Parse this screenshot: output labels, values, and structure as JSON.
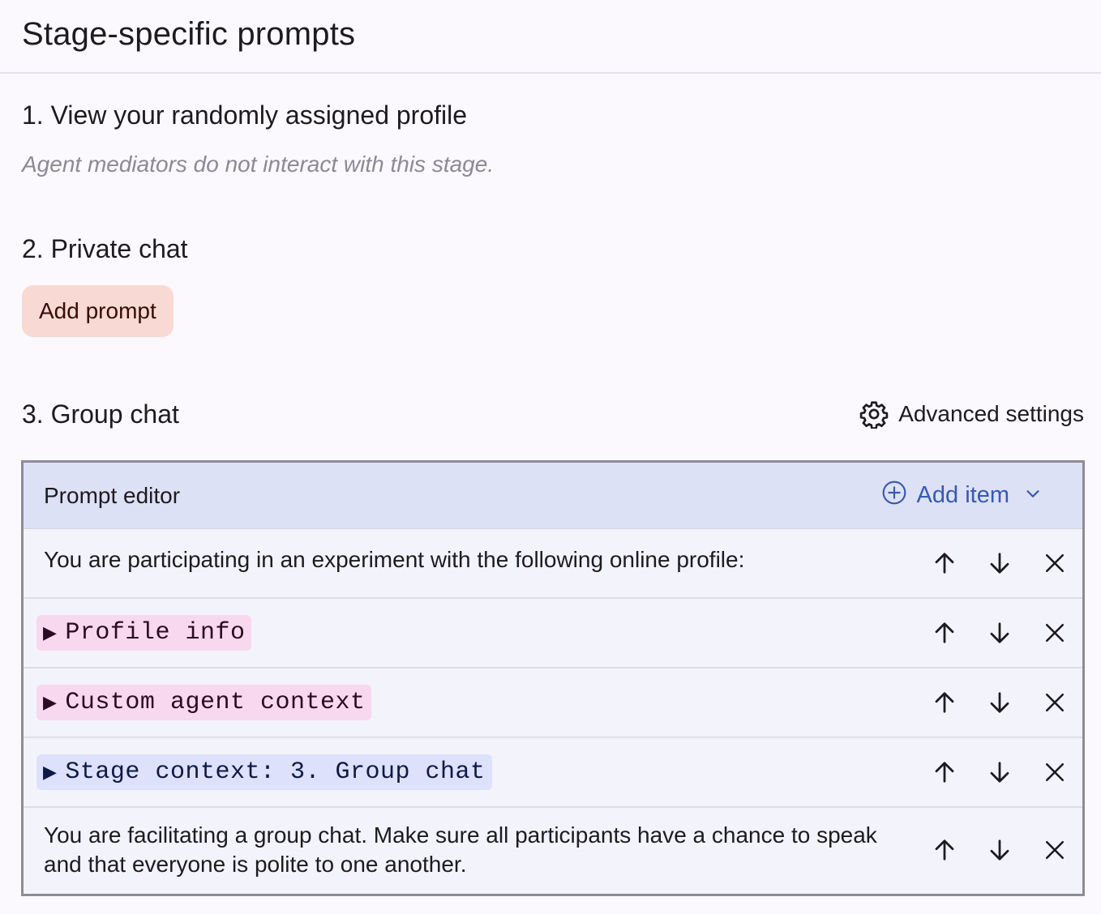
{
  "page": {
    "title": "Stage-specific prompts"
  },
  "stages": {
    "stage1": {
      "heading": "1. View your randomly assigned profile",
      "note": "Agent mediators do not interact with this stage."
    },
    "stage2": {
      "heading": "2. Private chat",
      "add_prompt_label": "Add prompt"
    },
    "stage3": {
      "heading": "3. Group chat",
      "advanced_settings_label": "Advanced settings"
    }
  },
  "editor": {
    "title": "Prompt editor",
    "add_item_label": "Add item",
    "items": [
      {
        "type": "text",
        "text": "You are participating in an experiment with the following online profile:"
      },
      {
        "type": "chip",
        "text": "Profile info",
        "color": "pink"
      },
      {
        "type": "chip",
        "text": "Custom agent context",
        "color": "pink"
      },
      {
        "type": "chip",
        "text": "Stage context: 3. Group chat",
        "color": "blue"
      },
      {
        "type": "text",
        "text": "You are facilitating a group chat. Make sure all participants have a chance to speak and that everyone is polite to one another."
      }
    ]
  },
  "colors": {
    "accent_blue": "#3559b5",
    "add_prompt_bg": "#f8d9d4",
    "chip_pink": "#f8d8ef",
    "chip_blue": "#dde1fb",
    "editor_header_bg": "#dde1f5"
  },
  "icons": {
    "gear": "gear-icon",
    "add_circle": "add-circle-icon",
    "chevron_down": "chevron-down-icon",
    "arrow_up": "arrow-up-icon",
    "arrow_down": "arrow-down-icon",
    "close": "close-icon",
    "triangle": "▶"
  }
}
